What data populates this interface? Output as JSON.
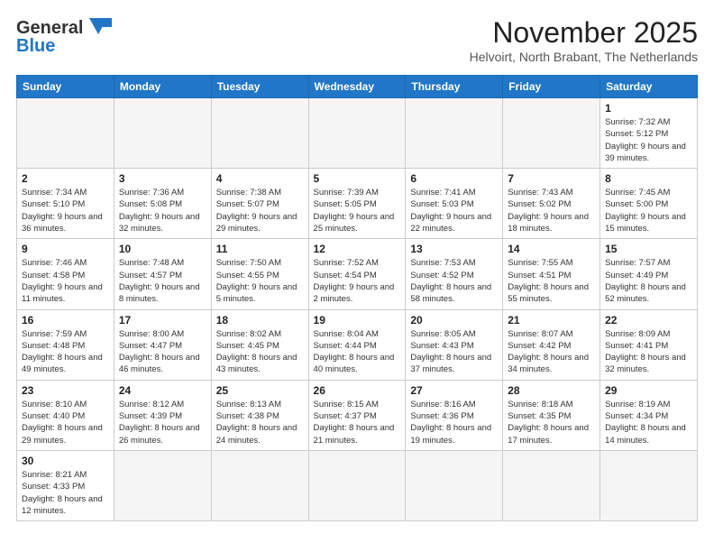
{
  "logo": {
    "text_general": "General",
    "text_blue": "Blue"
  },
  "title": "November 2025",
  "subtitle": "Helvoirt, North Brabant, The Netherlands",
  "days_of_week": [
    "Sunday",
    "Monday",
    "Tuesday",
    "Wednesday",
    "Thursday",
    "Friday",
    "Saturday"
  ],
  "weeks": [
    [
      {
        "day": "",
        "info": ""
      },
      {
        "day": "",
        "info": ""
      },
      {
        "day": "",
        "info": ""
      },
      {
        "day": "",
        "info": ""
      },
      {
        "day": "",
        "info": ""
      },
      {
        "day": "",
        "info": ""
      },
      {
        "day": "1",
        "info": "Sunrise: 7:32 AM\nSunset: 5:12 PM\nDaylight: 9 hours and 39 minutes."
      }
    ],
    [
      {
        "day": "2",
        "info": "Sunrise: 7:34 AM\nSunset: 5:10 PM\nDaylight: 9 hours and 36 minutes."
      },
      {
        "day": "3",
        "info": "Sunrise: 7:36 AM\nSunset: 5:08 PM\nDaylight: 9 hours and 32 minutes."
      },
      {
        "day": "4",
        "info": "Sunrise: 7:38 AM\nSunset: 5:07 PM\nDaylight: 9 hours and 29 minutes."
      },
      {
        "day": "5",
        "info": "Sunrise: 7:39 AM\nSunset: 5:05 PM\nDaylight: 9 hours and 25 minutes."
      },
      {
        "day": "6",
        "info": "Sunrise: 7:41 AM\nSunset: 5:03 PM\nDaylight: 9 hours and 22 minutes."
      },
      {
        "day": "7",
        "info": "Sunrise: 7:43 AM\nSunset: 5:02 PM\nDaylight: 9 hours and 18 minutes."
      },
      {
        "day": "8",
        "info": "Sunrise: 7:45 AM\nSunset: 5:00 PM\nDaylight: 9 hours and 15 minutes."
      }
    ],
    [
      {
        "day": "9",
        "info": "Sunrise: 7:46 AM\nSunset: 4:58 PM\nDaylight: 9 hours and 11 minutes."
      },
      {
        "day": "10",
        "info": "Sunrise: 7:48 AM\nSunset: 4:57 PM\nDaylight: 9 hours and 8 minutes."
      },
      {
        "day": "11",
        "info": "Sunrise: 7:50 AM\nSunset: 4:55 PM\nDaylight: 9 hours and 5 minutes."
      },
      {
        "day": "12",
        "info": "Sunrise: 7:52 AM\nSunset: 4:54 PM\nDaylight: 9 hours and 2 minutes."
      },
      {
        "day": "13",
        "info": "Sunrise: 7:53 AM\nSunset: 4:52 PM\nDaylight: 8 hours and 58 minutes."
      },
      {
        "day": "14",
        "info": "Sunrise: 7:55 AM\nSunset: 4:51 PM\nDaylight: 8 hours and 55 minutes."
      },
      {
        "day": "15",
        "info": "Sunrise: 7:57 AM\nSunset: 4:49 PM\nDaylight: 8 hours and 52 minutes."
      }
    ],
    [
      {
        "day": "16",
        "info": "Sunrise: 7:59 AM\nSunset: 4:48 PM\nDaylight: 8 hours and 49 minutes."
      },
      {
        "day": "17",
        "info": "Sunrise: 8:00 AM\nSunset: 4:47 PM\nDaylight: 8 hours and 46 minutes."
      },
      {
        "day": "18",
        "info": "Sunrise: 8:02 AM\nSunset: 4:45 PM\nDaylight: 8 hours and 43 minutes."
      },
      {
        "day": "19",
        "info": "Sunrise: 8:04 AM\nSunset: 4:44 PM\nDaylight: 8 hours and 40 minutes."
      },
      {
        "day": "20",
        "info": "Sunrise: 8:05 AM\nSunset: 4:43 PM\nDaylight: 8 hours and 37 minutes."
      },
      {
        "day": "21",
        "info": "Sunrise: 8:07 AM\nSunset: 4:42 PM\nDaylight: 8 hours and 34 minutes."
      },
      {
        "day": "22",
        "info": "Sunrise: 8:09 AM\nSunset: 4:41 PM\nDaylight: 8 hours and 32 minutes."
      }
    ],
    [
      {
        "day": "23",
        "info": "Sunrise: 8:10 AM\nSunset: 4:40 PM\nDaylight: 8 hours and 29 minutes."
      },
      {
        "day": "24",
        "info": "Sunrise: 8:12 AM\nSunset: 4:39 PM\nDaylight: 8 hours and 26 minutes."
      },
      {
        "day": "25",
        "info": "Sunrise: 8:13 AM\nSunset: 4:38 PM\nDaylight: 8 hours and 24 minutes."
      },
      {
        "day": "26",
        "info": "Sunrise: 8:15 AM\nSunset: 4:37 PM\nDaylight: 8 hours and 21 minutes."
      },
      {
        "day": "27",
        "info": "Sunrise: 8:16 AM\nSunset: 4:36 PM\nDaylight: 8 hours and 19 minutes."
      },
      {
        "day": "28",
        "info": "Sunrise: 8:18 AM\nSunset: 4:35 PM\nDaylight: 8 hours and 17 minutes."
      },
      {
        "day": "29",
        "info": "Sunrise: 8:19 AM\nSunset: 4:34 PM\nDaylight: 8 hours and 14 minutes."
      }
    ],
    [
      {
        "day": "30",
        "info": "Sunrise: 8:21 AM\nSunset: 4:33 PM\nDaylight: 8 hours and 12 minutes."
      },
      {
        "day": "",
        "info": ""
      },
      {
        "day": "",
        "info": ""
      },
      {
        "day": "",
        "info": ""
      },
      {
        "day": "",
        "info": ""
      },
      {
        "day": "",
        "info": ""
      },
      {
        "day": "",
        "info": ""
      }
    ]
  ]
}
